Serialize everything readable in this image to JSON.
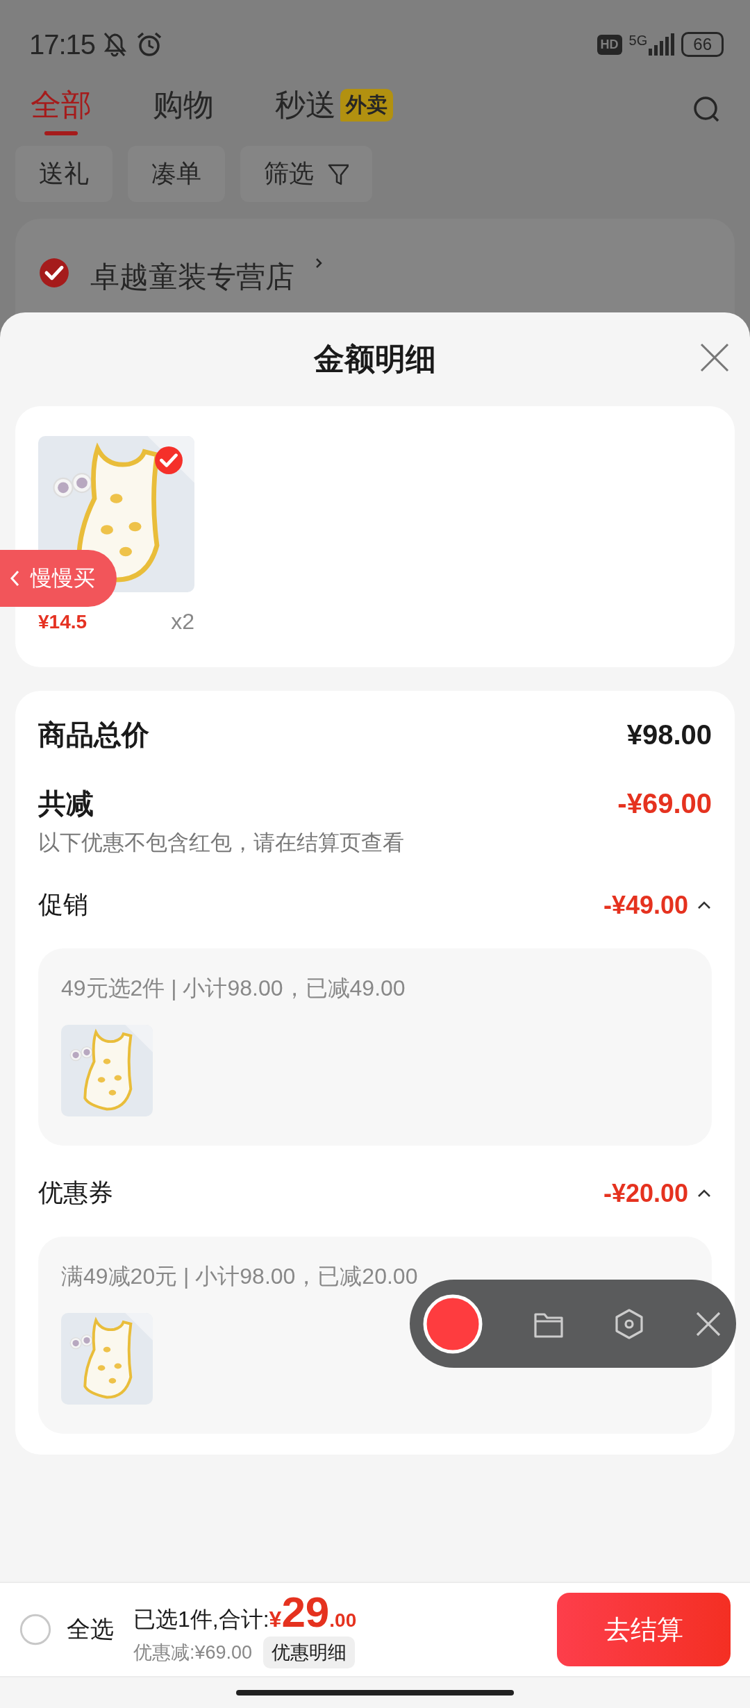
{
  "status_bar": {
    "time": "17:15",
    "network_badge": "HD",
    "network_type": "5G",
    "battery": "66"
  },
  "tabs": [
    {
      "label": "全部",
      "selected": true
    },
    {
      "label": "购物",
      "selected": false
    },
    {
      "label": "秒送",
      "selected": false,
      "badge": "外卖"
    }
  ],
  "chips": [
    {
      "label": "送礼",
      "kind": "plain"
    },
    {
      "label": "凑单",
      "kind": "plain"
    },
    {
      "label": "筛选",
      "kind": "filter"
    }
  ],
  "store": {
    "name": "卓越童装专营店",
    "checked": true
  },
  "sheet": {
    "title": "金额明细",
    "items": [
      {
        "kind": "picture",
        "checked": true,
        "price": "¥14.5",
        "quantity": "x2"
      }
    ],
    "summary": {
      "total_label": "商品总价",
      "total": "¥98.00",
      "reduction_label": "共减",
      "reduction": "-¥69.00",
      "note": "以下优惠不包含红包，请在结算页查看"
    },
    "discounts": [
      {
        "label": "促销",
        "amount": "-¥49.00",
        "expanded": true,
        "detail": "49元选2件 | 小计98.00，已减49.00"
      },
      {
        "label": "优惠券",
        "amount": "-¥20.00",
        "expanded": true,
        "detail": "满49减20元 | 小计98.00，已减20.00"
      }
    ]
  },
  "floating_button": {
    "label": "慢慢买"
  },
  "bottom_bar": {
    "select_all": {
      "label": "全选",
      "checked": false
    },
    "summary": "已选1件,合计:",
    "currency": "¥",
    "price_int": "29",
    "price_dec": ".00",
    "saved": "优惠减:¥69.00",
    "detail_button": "优惠明细",
    "checkout_button": "去结算"
  }
}
